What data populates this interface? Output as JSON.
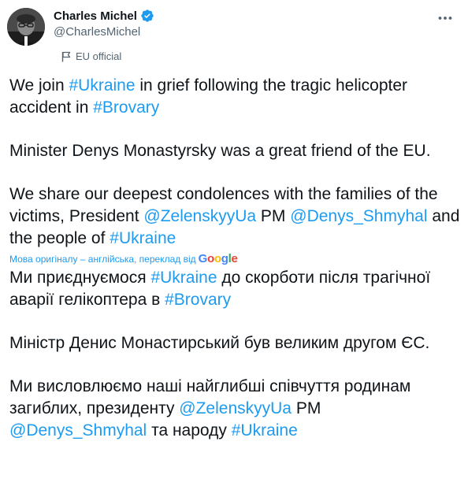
{
  "author": {
    "display_name": "Charles Michel",
    "handle": "@CharlesMichel",
    "affiliation_label": "EU official",
    "verified_icon": "verified-badge-icon",
    "accent_color": "#1d9bf0"
  },
  "more_icon": "more-horizontal-icon",
  "original": {
    "p1": {
      "t1": "We join ",
      "tag1": "#Ukraine",
      "t2": " in grief following the tragic helicopter accident in ",
      "tag2": "#Brovary"
    },
    "p2": "Minister Denys Monastyrsky was a great friend of the EU.",
    "p3": {
      "t1": "We share our deepest condolences with the families of the victims, President ",
      "mention1": "@ZelenskyyUa",
      "t2": " PM ",
      "mention2": "@Denys_Shmyhal",
      "t3": " and the people of ",
      "tag1": "#Ukraine"
    }
  },
  "translation_note": {
    "text": "Мова оригіналу – англійська, переклад від",
    "provider": "Google"
  },
  "translated": {
    "p1": {
      "t1": "Ми приєднуємося ",
      "tag1": "#Ukraine",
      "t2": " до скорботи після трагічної аварії гелікоптера в ",
      "tag2": "#Brovary"
    },
    "p2": "Міністр Денис Монастирський був великим другом ЄС.",
    "p3": {
      "t1": "Ми висловлюємо наші найглибші співчуття родинам загиблих, президенту ",
      "mention1": "@ZelenskyyUa",
      "t2": " PM ",
      "mention2": "@Denys_Shmyhal",
      "t3": " та народу ",
      "tag1": "#Ukraine"
    }
  }
}
